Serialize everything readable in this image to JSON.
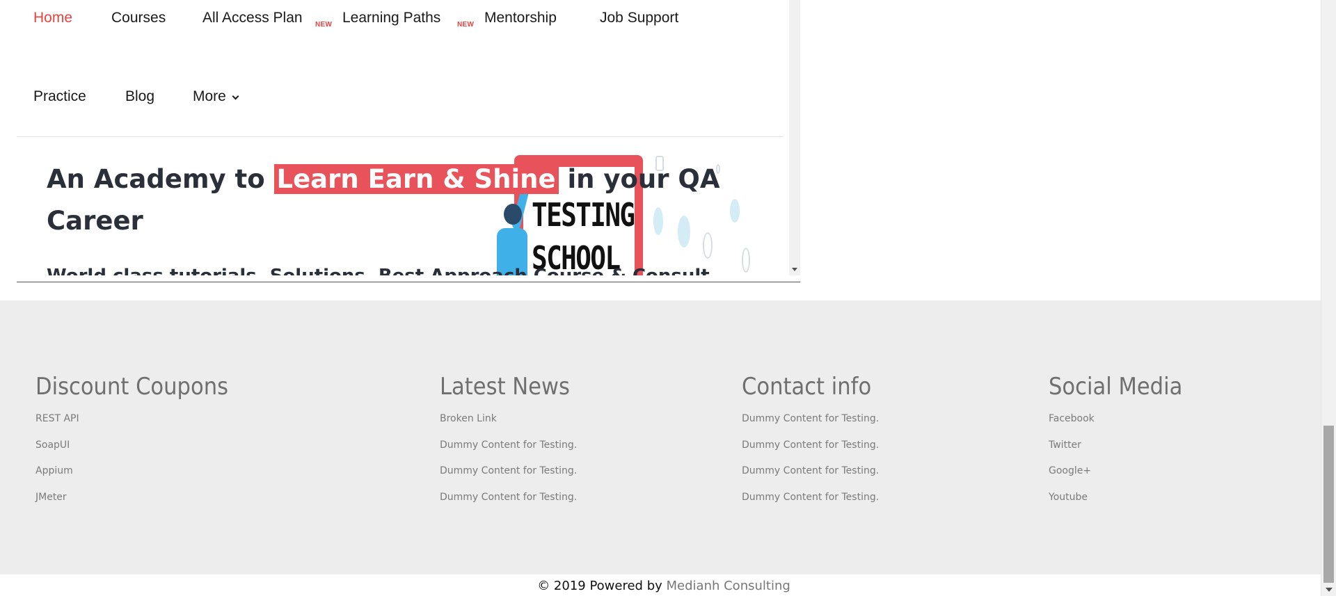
{
  "nav": {
    "row1": [
      {
        "label": "Home",
        "active": true
      },
      {
        "label": "Courses"
      },
      {
        "label": "All Access Plan",
        "badge": "NEW"
      },
      {
        "label": "Learning Paths",
        "badge": "NEW"
      },
      {
        "label": "Mentorship"
      },
      {
        "label": "Job Support"
      }
    ],
    "row2": [
      {
        "label": "Practice"
      },
      {
        "label": "Blog"
      },
      {
        "label": "More"
      }
    ]
  },
  "hero": {
    "title_pre": "An Academy to ",
    "title_highlight": "Learn Earn & Shine",
    "title_post": "  in your QA Career",
    "board_line1": "TESTING",
    "board_line2": "SCHOOL",
    "subtitle_partial": "World class tutorials, Solutions, Best Approach Course & Consult"
  },
  "footer": {
    "columns": [
      {
        "title": "Discount Coupons",
        "items": [
          "REST API",
          "SoapUI",
          "Appium",
          "JMeter"
        ]
      },
      {
        "title": "Latest News",
        "items": [
          "Broken Link",
          "Dummy Content for Testing.",
          "Dummy Content for Testing.",
          "Dummy Content for Testing."
        ]
      },
      {
        "title": "Contact info",
        "items": [
          "Dummy Content for Testing.",
          "Dummy Content for Testing.",
          "Dummy Content for Testing.",
          "Dummy Content for Testing."
        ]
      },
      {
        "title": "Social Media",
        "items": [
          "Facebook",
          "Twitter",
          "Google+",
          "Youtube"
        ]
      }
    ],
    "copyright_prefix": "© 2019 Powered by ",
    "copyright_brand": "Medianh Consulting"
  },
  "colors": {
    "accent": "#e8433f",
    "highlight": "#e8525a",
    "footer_bg": "#ededed"
  }
}
